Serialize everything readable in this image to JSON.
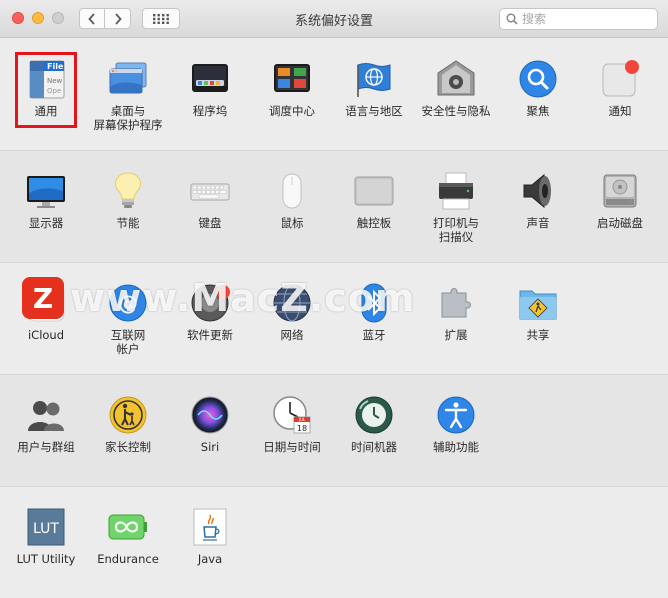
{
  "window": {
    "title": "系统偏好设置"
  },
  "toolbar": {
    "search_placeholder": "搜索"
  },
  "rows": [
    [
      {
        "label": "通用",
        "icon": "general-icon"
      },
      {
        "label": "桌面与\n屏幕保护程序",
        "icon": "desktop-icon"
      },
      {
        "label": "程序坞",
        "icon": "dock-icon"
      },
      {
        "label": "调度中心",
        "icon": "mission-control-icon"
      },
      {
        "label": "语言与地区",
        "icon": "language-icon"
      },
      {
        "label": "安全性与隐私",
        "icon": "security-icon"
      },
      {
        "label": "聚焦",
        "icon": "spotlight-icon"
      },
      {
        "label": "通知",
        "icon": "notifications-icon"
      }
    ],
    [
      {
        "label": "显示器",
        "icon": "display-icon"
      },
      {
        "label": "节能",
        "icon": "energy-icon"
      },
      {
        "label": "键盘",
        "icon": "keyboard-icon"
      },
      {
        "label": "鼠标",
        "icon": "mouse-icon"
      },
      {
        "label": "触控板",
        "icon": "trackpad-icon"
      },
      {
        "label": "打印机与\n扫描仪",
        "icon": "printer-icon"
      },
      {
        "label": "声音",
        "icon": "sound-icon"
      },
      {
        "label": "启动磁盘",
        "icon": "startup-disk-icon"
      }
    ],
    [
      {
        "label": "iCloud",
        "icon": "icloud-icon"
      },
      {
        "label": "互联网\n帐户",
        "icon": "internet-accounts-icon"
      },
      {
        "label": "软件更新",
        "icon": "software-update-icon"
      },
      {
        "label": "网络",
        "icon": "network-icon"
      },
      {
        "label": "蓝牙",
        "icon": "bluetooth-icon"
      },
      {
        "label": "扩展",
        "icon": "extensions-icon"
      },
      {
        "label": "共享",
        "icon": "sharing-icon"
      }
    ],
    [
      {
        "label": "用户与群组",
        "icon": "users-icon"
      },
      {
        "label": "家长控制",
        "icon": "parental-icon"
      },
      {
        "label": "Siri",
        "icon": "siri-icon"
      },
      {
        "label": "日期与时间",
        "icon": "datetime-icon"
      },
      {
        "label": "时间机器",
        "icon": "time-machine-icon"
      },
      {
        "label": "辅助功能",
        "icon": "accessibility-icon"
      }
    ],
    [
      {
        "label": "LUT Utility",
        "icon": "lut-icon"
      },
      {
        "label": "Endurance",
        "icon": "endurance-icon"
      },
      {
        "label": "Java",
        "icon": "java-icon"
      }
    ]
  ],
  "icon_text": {
    "general_file": "File",
    "general_new": "New",
    "general_open": "Ope",
    "lut": "LUT",
    "date_day": "18",
    "date_month": "JUL"
  },
  "watermark": {
    "text": "www.MacZ.com",
    "logo": "Z"
  },
  "colors": {
    "highlight": "#e3141c"
  }
}
